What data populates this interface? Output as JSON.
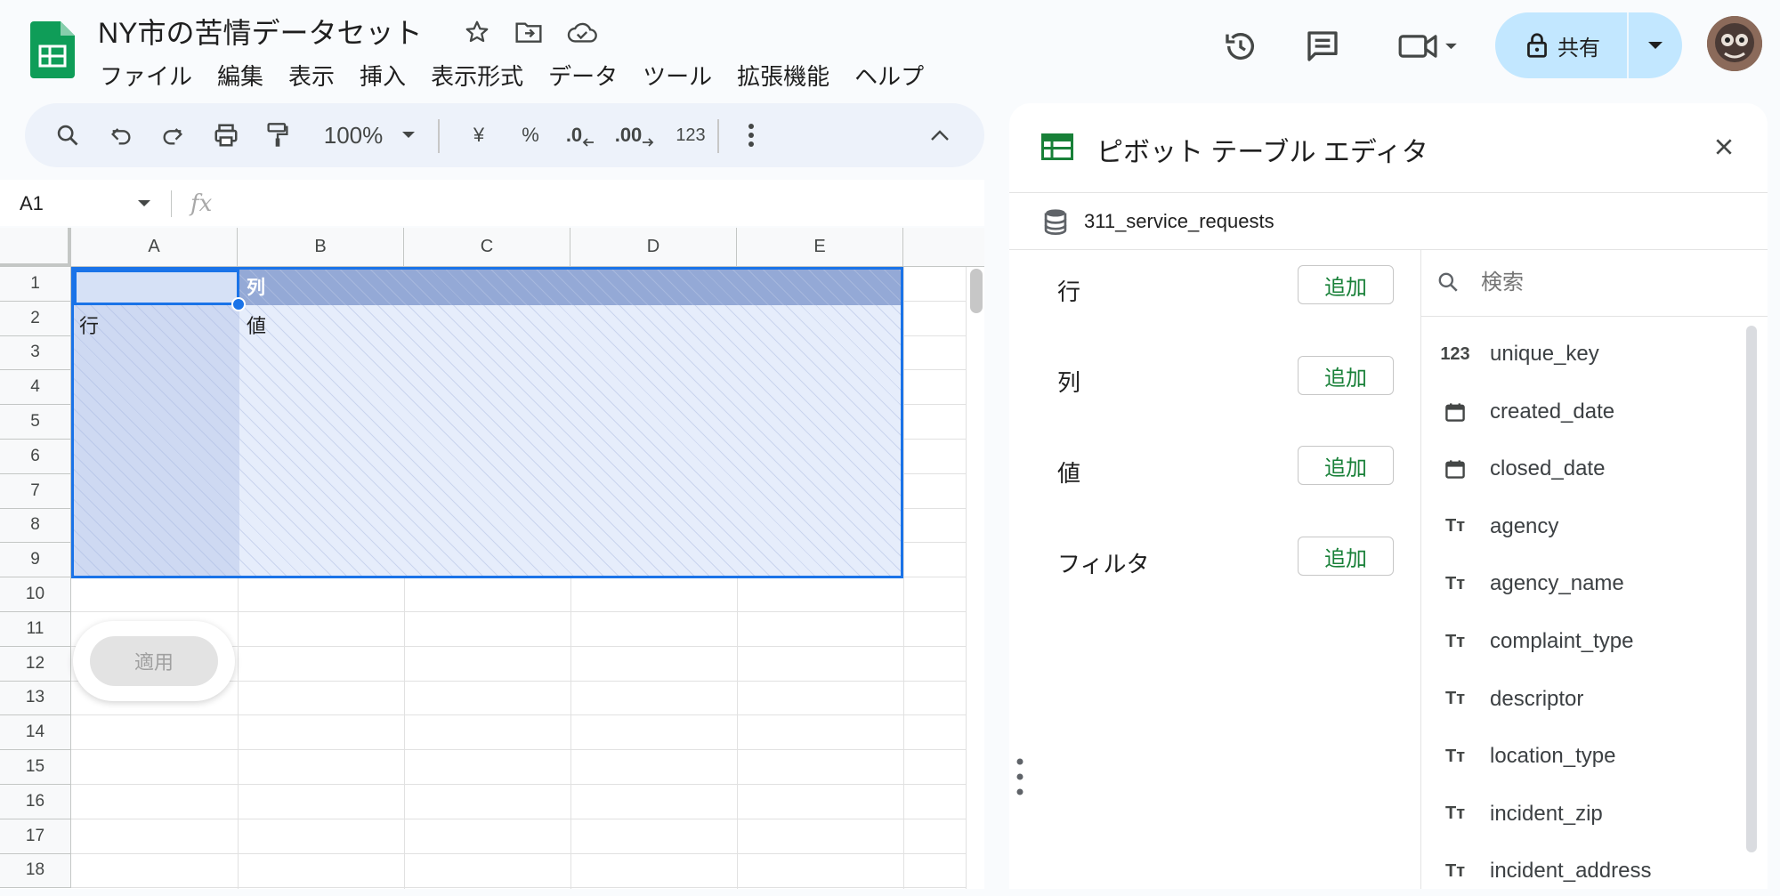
{
  "header": {
    "title": "NY市の苦情データセット",
    "menu": [
      "ファイル",
      "編集",
      "表示",
      "挿入",
      "表示形式",
      "データ",
      "ツール",
      "拡張機能",
      "ヘルプ"
    ],
    "share_label": "共有"
  },
  "toolbar": {
    "zoom": "100%",
    "currency": "¥",
    "percent": "%",
    "decrease_decimal": ".0",
    "increase_decimal": ".00",
    "number_format": "123"
  },
  "formula_bar": {
    "name_box": "A1",
    "fx": "fx"
  },
  "grid": {
    "columns": [
      "A",
      "B",
      "C",
      "D",
      "E"
    ],
    "rows": [
      "1",
      "2",
      "3",
      "4",
      "5",
      "6",
      "7",
      "8",
      "9",
      "10",
      "11",
      "12",
      "13",
      "14",
      "15",
      "16",
      "17",
      "18"
    ],
    "pivot_labels": {
      "col": "列",
      "row": "行",
      "value": "値"
    },
    "apply_label": "適用"
  },
  "panel": {
    "title": "ピボット テーブル エディタ",
    "source": "311_service_requests",
    "sections": [
      {
        "label": "行",
        "button": "追加"
      },
      {
        "label": "列",
        "button": "追加"
      },
      {
        "label": "値",
        "button": "追加"
      },
      {
        "label": "フィルタ",
        "button": "追加"
      }
    ],
    "search_placeholder": "検索",
    "fields": [
      {
        "name": "unique_key",
        "icon": "number-icon",
        "glyph": "123"
      },
      {
        "name": "created_date",
        "icon": "calendar-icon",
        "glyph": ""
      },
      {
        "name": "closed_date",
        "icon": "calendar-icon",
        "glyph": ""
      },
      {
        "name": "agency",
        "icon": "text-type-icon",
        "glyph": "Tт"
      },
      {
        "name": "agency_name",
        "icon": "text-type-icon",
        "glyph": "Tт"
      },
      {
        "name": "complaint_type",
        "icon": "text-type-icon",
        "glyph": "Tт"
      },
      {
        "name": "descriptor",
        "icon": "text-type-icon",
        "glyph": "Tт"
      },
      {
        "name": "location_type",
        "icon": "text-type-icon",
        "glyph": "Tт"
      },
      {
        "name": "incident_zip",
        "icon": "text-type-icon",
        "glyph": "Tт"
      },
      {
        "name": "incident_address",
        "icon": "text-type-icon",
        "glyph": "Tт"
      }
    ]
  },
  "colors": {
    "accent": "#1a73e8",
    "share_bg": "#c2e7ff",
    "add_text": "#188038",
    "sheets_green": "#0f9d58"
  }
}
